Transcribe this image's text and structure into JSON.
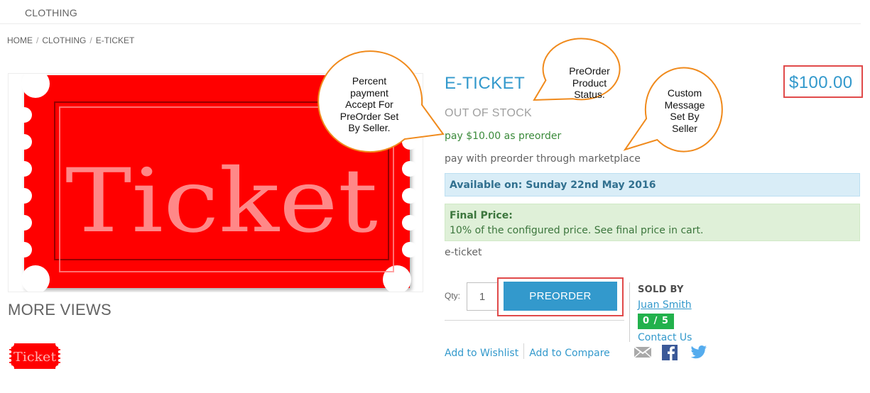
{
  "nav": {
    "category": "CLOTHING"
  },
  "breadcrumb": {
    "home": "HOME",
    "category": "CLOTHING",
    "current": "E-TICKET",
    "separator": "/"
  },
  "product": {
    "image_text": "Ticket",
    "image_color": "#ff0000",
    "name": "E-TICKET",
    "price": "$100.00",
    "stock_status": "OUT OF STOCK",
    "preorder_payment": "pay $10.00 as preorder",
    "custom_message": "pay with preorder through marketplace",
    "availability": "Available on: Sunday 22nd May 2016",
    "final_price_title": "Final Price:",
    "final_price_text": "10% of the configured price. See final price in cart.",
    "short_description": "e-ticket"
  },
  "more_views": {
    "heading": "MORE VIEWS",
    "thumb_text": "Ticket"
  },
  "cart": {
    "qty_label": "Qty:",
    "qty_value": "1",
    "preorder_button": "PREORDER"
  },
  "links": {
    "wishlist": "Add to Wishlist",
    "compare": "Add to Compare"
  },
  "seller": {
    "heading": "SOLD BY",
    "name": "Juan Smith",
    "rating": "0 / 5",
    "contact": "Contact Us",
    "social_icons": [
      "mail-icon",
      "facebook-icon",
      "twitter-icon"
    ]
  },
  "callouts": {
    "percent": "Percent\npayment\nAccept For\nPreOrder Set\nBy Seller.",
    "status": "PreOrder\nProduct\nStatus.",
    "custom": "Custom\nMessage\nSet By\nSeller"
  },
  "colors": {
    "accent": "#3399cc",
    "highlight": "#e04a4a",
    "callout_border": "#f08a1c",
    "rating_green": "#22b14c"
  }
}
